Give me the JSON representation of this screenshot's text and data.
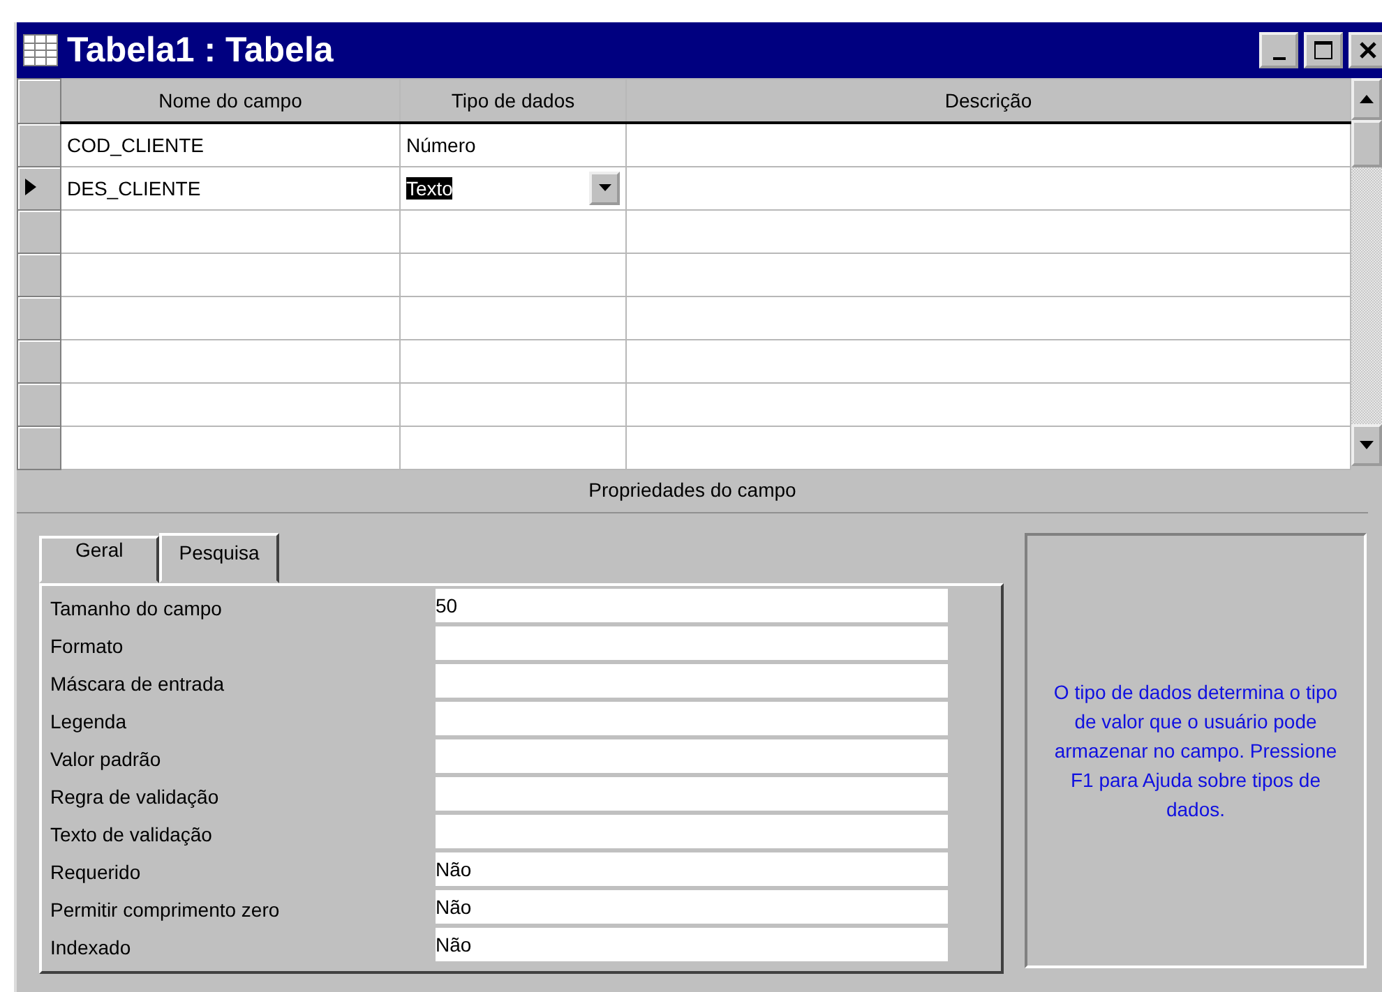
{
  "window": {
    "title": "Tabela1 : Tabela"
  },
  "table": {
    "columns": [
      "Nome do campo",
      "Tipo de dados",
      "Descrição"
    ],
    "rows": [
      {
        "field_name": "COD_CLIENTE",
        "data_type": "Número",
        "selected": false
      },
      {
        "field_name": "DES_CLIENTE",
        "data_type": "Texto",
        "selected": true
      }
    ]
  },
  "properties": {
    "title": "Propriedades do campo",
    "tabs": [
      {
        "label": "Geral",
        "selected": true
      },
      {
        "label": "Pesquisa",
        "selected": false
      }
    ],
    "rows": [
      {
        "label": "Tamanho do campo",
        "value": "50"
      },
      {
        "label": "Formato"
      },
      {
        "label": "Máscara de entrada"
      },
      {
        "label": "Legenda"
      },
      {
        "label": "Valor padrão"
      },
      {
        "label": "Regra de validação"
      },
      {
        "label": "Texto de validação"
      },
      {
        "label": "Requerido",
        "value": "Não"
      },
      {
        "label": "Permitir comprimento zero",
        "value": "Não"
      },
      {
        "label": "Indexado",
        "value": "Não"
      }
    ],
    "help": "O tipo de dados determina o tipo de valor que o usuário pode armazenar no campo. Pressione F1 para Ajuda sobre tipos de dados."
  }
}
